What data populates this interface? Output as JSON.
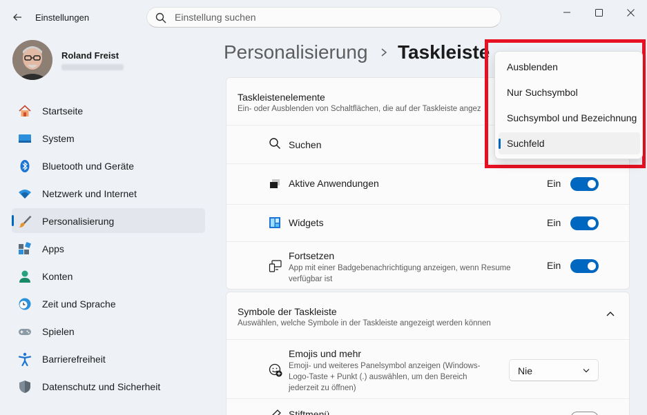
{
  "window": {
    "title": "Einstellungen",
    "controls": [
      "minimize",
      "maximize",
      "close"
    ]
  },
  "search": {
    "placeholder": "Einstellung suchen",
    "value": ""
  },
  "profile": {
    "name": "Roland Freist"
  },
  "sidebar": {
    "items": [
      {
        "label": "Startseite",
        "icon": "home-icon"
      },
      {
        "label": "System",
        "icon": "monitor-icon"
      },
      {
        "label": "Bluetooth und Geräte",
        "icon": "bluetooth-icon"
      },
      {
        "label": "Netzwerk und Internet",
        "icon": "wifi-icon"
      },
      {
        "label": "Personalisierung",
        "icon": "brush-icon",
        "active": true
      },
      {
        "label": "Apps",
        "icon": "apps-icon"
      },
      {
        "label": "Konten",
        "icon": "account-icon"
      },
      {
        "label": "Zeit und Sprache",
        "icon": "clock-globe-icon"
      },
      {
        "label": "Spielen",
        "icon": "gamepad-icon"
      },
      {
        "label": "Barrierefreiheit",
        "icon": "accessibility-icon"
      },
      {
        "label": "Datenschutz und Sicherheit",
        "icon": "shield-icon"
      }
    ]
  },
  "breadcrumb": {
    "parent": "Personalisierung",
    "current": "Taskleiste"
  },
  "section1": {
    "title": "Taskleistenelemente",
    "subtitle": "Ein- oder Ausblenden von Schaltflächen, die auf der Taskleiste angez",
    "rows": [
      {
        "label": "Suchen",
        "icon": "search-icon"
      },
      {
        "label": "Aktive Anwendungen",
        "icon": "taskview-icon",
        "state": "Ein"
      },
      {
        "label": "Widgets",
        "icon": "widgets-icon",
        "state": "Ein"
      },
      {
        "label": "Fortsetzen",
        "icon": "resume-icon",
        "state": "Ein",
        "description_line1": "App mit einer Badgebenachrichtigung anzeigen, wenn Resume",
        "description_line2": "verfügbar ist"
      }
    ]
  },
  "section2": {
    "title": "Symbole der Taskleiste",
    "subtitle": "Auswählen, welche Symbole in der Taskleiste angezeigt werden können",
    "rows": [
      {
        "label": "Emojis und mehr",
        "icon": "emoji-icon",
        "description_line1": "Emoji- und weiteres Panelsymbol anzeigen (Windows-",
        "description_line2": "Logo-Taste + Punkt (.) auswählen, um den Bereich",
        "description_line3": "jederzeit zu öffnen)",
        "select_value": "Nie"
      },
      {
        "label": "Stiftmenü",
        "icon": "pen-icon"
      }
    ]
  },
  "dropdown": {
    "options": [
      "Ausblenden",
      "Nur Suchsymbol",
      "Suchsymbol und Bezeichnung",
      "Suchfeld"
    ],
    "selected": "Suchfeld"
  },
  "colors": {
    "accent": "#0067c0",
    "highlight": "#e81123",
    "background": "#eef2f7"
  }
}
